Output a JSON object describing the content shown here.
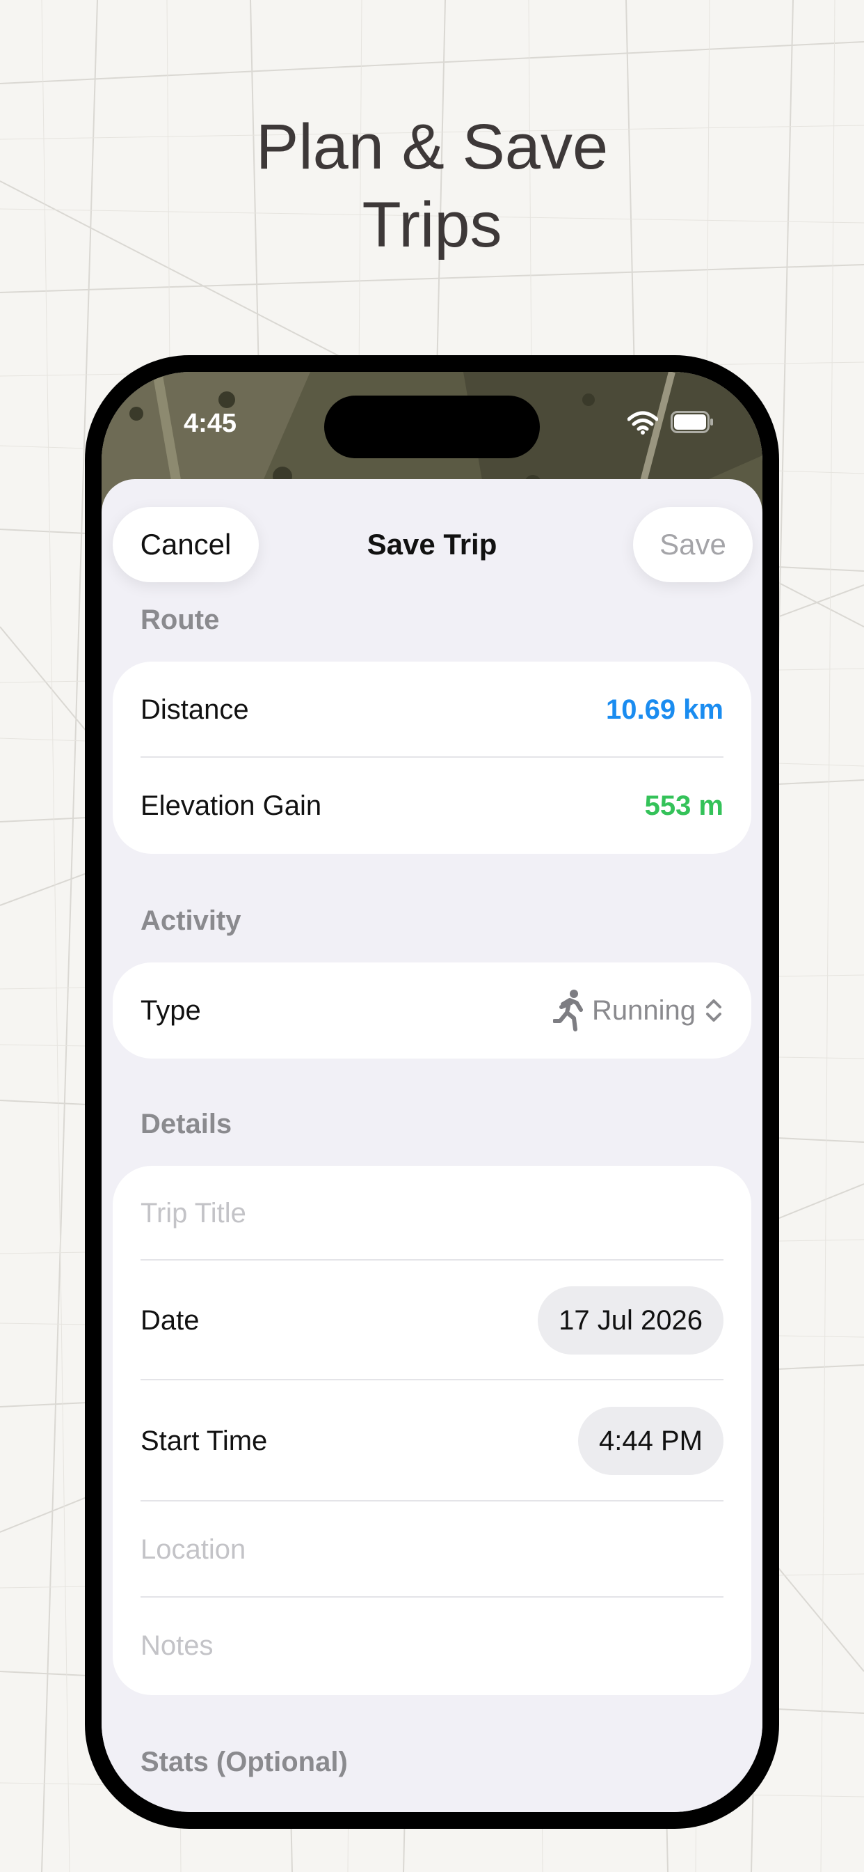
{
  "headline": {
    "line1": "Plan & Save",
    "line2": "Trips"
  },
  "status_bar": {
    "time": "4:45"
  },
  "nav": {
    "cancel": "Cancel",
    "title": "Save Trip",
    "save": "Save"
  },
  "sections": {
    "route": {
      "header": "Route",
      "distance_label": "Distance",
      "distance_value": "10.69 km",
      "elevation_label": "Elevation Gain",
      "elevation_value": "553 m"
    },
    "activity": {
      "header": "Activity",
      "type_label": "Type",
      "type_value": "Running"
    },
    "details": {
      "header": "Details",
      "title_placeholder": "Trip Title",
      "date_label": "Date",
      "date_value": "17 Jul 2026",
      "start_label": "Start Time",
      "start_value": "4:44 PM",
      "location_placeholder": "Location",
      "notes_placeholder": "Notes"
    },
    "stats": {
      "header": "Stats (Optional)"
    }
  },
  "colors": {
    "distance": "#1a8cf0",
    "elevation": "#34c259",
    "muted": "#8a8a8e",
    "sheet_bg": "#f1f0f6"
  },
  "icons": {
    "activity_type": "running-figure-icon",
    "picker": "chevron-up-down-icon",
    "wifi": "wifi-icon",
    "battery": "battery-icon"
  }
}
